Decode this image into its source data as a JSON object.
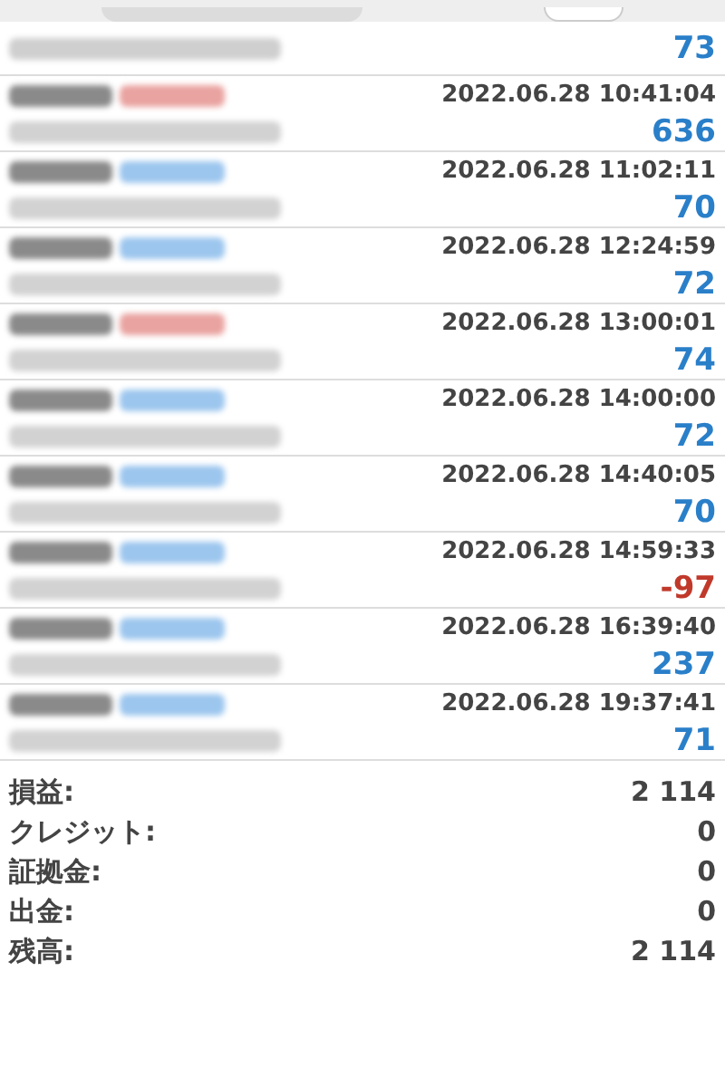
{
  "first_row": {
    "profit": "73",
    "loss": false
  },
  "trades": [
    {
      "kind": "sell",
      "time": "2022.06.28 10:41:04",
      "profit": "636",
      "loss": false
    },
    {
      "kind": "buy",
      "time": "2022.06.28 11:02:11",
      "profit": "70",
      "loss": false
    },
    {
      "kind": "buy",
      "time": "2022.06.28 12:24:59",
      "profit": "72",
      "loss": false
    },
    {
      "kind": "sell",
      "time": "2022.06.28 13:00:01",
      "profit": "74",
      "loss": false
    },
    {
      "kind": "buy",
      "time": "2022.06.28 14:00:00",
      "profit": "72",
      "loss": false
    },
    {
      "kind": "buy",
      "time": "2022.06.28 14:40:05",
      "profit": "70",
      "loss": false
    },
    {
      "kind": "buy",
      "time": "2022.06.28 14:59:33",
      "profit": "-97",
      "loss": true
    },
    {
      "kind": "buy",
      "time": "2022.06.28 16:39:40",
      "profit": "237",
      "loss": false
    },
    {
      "kind": "buy",
      "time": "2022.06.28 19:37:41",
      "profit": "71",
      "loss": false
    }
  ],
  "summary": [
    {
      "label": "損益:",
      "value": "2 114"
    },
    {
      "label": "クレジット:",
      "value": "0"
    },
    {
      "label": "証拠金:",
      "value": "0"
    },
    {
      "label": "出金:",
      "value": "0"
    },
    {
      "label": "残高:",
      "value": "2 114"
    }
  ]
}
